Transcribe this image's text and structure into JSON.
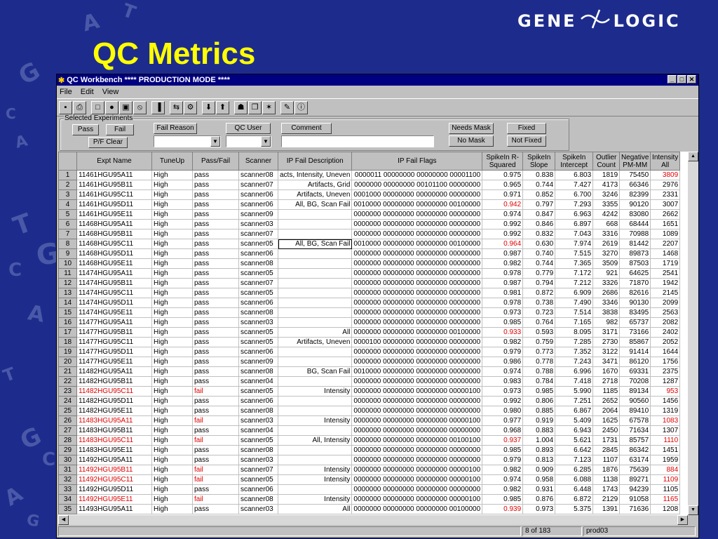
{
  "slide": {
    "title": "QC Metrics"
  },
  "logo": {
    "left": "GENE",
    "right": "LOGIC"
  },
  "bg_letters": [
    "A",
    "T",
    "G",
    "C",
    "A",
    "T",
    "G",
    "C",
    "A",
    "T",
    "G",
    "C",
    "A",
    "G"
  ],
  "window": {
    "title": "QC Workbench **** PRODUCTION MODE ****",
    "controls": [
      "_",
      "□",
      "✕"
    ],
    "menu": [
      "File",
      "Edit",
      "View"
    ]
  },
  "toolbar_icons": [
    {
      "name": "save-icon",
      "glyph": "▪"
    },
    {
      "name": "print-icon",
      "glyph": "⎙"
    },
    {
      "name": "print-preview-icon",
      "glyph": "□"
    },
    {
      "name": "camera-icon",
      "glyph": "●"
    },
    {
      "name": "copy-icon",
      "glyph": "▣"
    },
    {
      "name": "no-entry-icon",
      "glyph": "⦸"
    },
    {
      "name": "chart-icon",
      "glyph": "▐"
    },
    {
      "name": "transfer-icon",
      "glyph": "⇆"
    },
    {
      "name": "gear-icon",
      "glyph": "⚙"
    },
    {
      "name": "arrow-down-icon",
      "glyph": "⬇"
    },
    {
      "name": "arrow-up-icon",
      "glyph": "⬆"
    },
    {
      "name": "scanner-icon",
      "glyph": "☗"
    },
    {
      "name": "document-icon",
      "glyph": "❐"
    },
    {
      "name": "stamp-icon",
      "glyph": "✶"
    },
    {
      "name": "edit-icon",
      "glyph": "✎"
    },
    {
      "name": "info-icon",
      "glyph": "ⓘ"
    }
  ],
  "selected_experiments": {
    "legend": "Selected Experiments",
    "pass": "Pass",
    "fail": "Fail",
    "pf_clear": "P/F Clear",
    "fail_reason": "Fail Reason",
    "qc_user": "QC User",
    "comment": "Comment",
    "needs_mask": "Needs Mask",
    "no_mask": "No Mask",
    "fixed": "Fixed",
    "not_fixed": "Not Fixed"
  },
  "columns": [
    "Expt Name",
    "TuneUp",
    "Pass/Fail",
    "Scanner",
    "IP Fail Description",
    "IP Fail Flags",
    "SpikeIn R-Squared",
    "SpikeIn Slope",
    "SpikeIn Intercept",
    "Outlier Count",
    "Negative PM-MM",
    "Intensity All"
  ],
  "rows": [
    [
      "1",
      "11461HGU95A11",
      "High",
      "pass",
      "scanner08",
      "acts, Intensity, Uneven",
      "0000011 00000000 00000000 00001100",
      "0.975",
      "0.838",
      "6.803",
      "1819",
      "75450",
      "3809"
    ],
    [
      "2",
      "11461HGU95B11",
      "High",
      "pass",
      "scanner07",
      "Artifacts, Grid",
      "0000000 00000000 00101100 00000000",
      "0.965",
      "0.744",
      "7.427",
      "4173",
      "66346",
      "2976"
    ],
    [
      "3",
      "11461HGU95C11",
      "High",
      "pass",
      "scanner06",
      "Artifacts, Uneven",
      "0001000 00000000 00000000 00000000",
      "0.971",
      "0.852",
      "6.700",
      "3246",
      "82399",
      "2331"
    ],
    [
      "4",
      "11461HGU95D11",
      "High",
      "pass",
      "scanner06",
      "All, BG, Scan Fail",
      "0010000 00000000 00000000 00100000",
      "0.942",
      "0.797",
      "7.293",
      "3355",
      "90120",
      "3007"
    ],
    [
      "5",
      "11461HGU95E11",
      "High",
      "pass",
      "scanner09",
      "",
      "0000000 00000000 00000000 00000000",
      "0.974",
      "0.847",
      "6.963",
      "4242",
      "83080",
      "2662"
    ],
    [
      "6",
      "11468HGU95A11",
      "High",
      "pass",
      "scanner03",
      "",
      "0000000 00000000 00000000 00000000",
      "0.992",
      "0.846",
      "6.897",
      "668",
      "68444",
      "1651"
    ],
    [
      "7",
      "11468HGU95B11",
      "High",
      "pass",
      "scanner07",
      "",
      "0000000 00000000 00000000 00000000",
      "0.992",
      "0.832",
      "7.043",
      "3316",
      "70988",
      "1089"
    ],
    [
      "8",
      "11468HGU95C11",
      "High",
      "pass",
      "scanner05",
      "All, BG, Scan Fail",
      "0010000 00000000 00000000 00100000",
      "0.964",
      "0.630",
      "7.974",
      "2619",
      "81442",
      "2207"
    ],
    [
      "9",
      "11468HGU95D11",
      "High",
      "pass",
      "scanner06",
      "",
      "0000000 00000000 00000000 00000000",
      "0.987",
      "0.740",
      "7.515",
      "3270",
      "89873",
      "1468"
    ],
    [
      "10",
      "11468HGU95E11",
      "High",
      "pass",
      "scanner08",
      "",
      "0000000 00000000 00000000 00000000",
      "0.982",
      "0.744",
      "7.365",
      "3509",
      "87503",
      "1719"
    ],
    [
      "11",
      "11474HGU95A11",
      "High",
      "pass",
      "scanner05",
      "",
      "0000000 00000000 00000000 00000000",
      "0.978",
      "0.779",
      "7.172",
      "921",
      "64625",
      "2541"
    ],
    [
      "12",
      "11474HGU95B11",
      "High",
      "pass",
      "scanner07",
      "",
      "0000000 00000000 00000000 00000000",
      "0.987",
      "0.794",
      "7.212",
      "3326",
      "71870",
      "1942"
    ],
    [
      "13",
      "11474HGU95C11",
      "High",
      "pass",
      "scanner05",
      "",
      "0000000 00000000 00000000 00000000",
      "0.981",
      "0.872",
      "6.909",
      "2686",
      "82616",
      "2145"
    ],
    [
      "14",
      "11474HGU95D11",
      "High",
      "pass",
      "scanner06",
      "",
      "0000000 00000000 00000000 00000000",
      "0.978",
      "0.738",
      "7.490",
      "3346",
      "90130",
      "2099"
    ],
    [
      "15",
      "11474HGU95E11",
      "High",
      "pass",
      "scanner08",
      "",
      "0000000 00000000 00000000 00000000",
      "0.973",
      "0.723",
      "7.514",
      "3838",
      "83495",
      "2563"
    ],
    [
      "16",
      "11477HGU95A11",
      "High",
      "pass",
      "scanner03",
      "",
      "0000000 00000000 00000000 00000000",
      "0.985",
      "0.764",
      "7.165",
      "982",
      "65737",
      "2082"
    ],
    [
      "17",
      "11477HGU95B11",
      "High",
      "pass",
      "scanner05",
      "All",
      "0000000 00000000 00000000 00100000",
      "0.933",
      "0.593",
      "8.095",
      "3171",
      "73166",
      "2402"
    ],
    [
      "18",
      "11477HGU95C11",
      "High",
      "pass",
      "scanner05",
      "Artifacts, Uneven",
      "0000100 00000000 00000000 00000000",
      "0.982",
      "0.759",
      "7.285",
      "2730",
      "85867",
      "2052"
    ],
    [
      "19",
      "11477HGU95D11",
      "High",
      "pass",
      "scanner06",
      "",
      "0000000 00000000 00000000 00000000",
      "0.979",
      "0.773",
      "7.352",
      "3122",
      "91414",
      "1644"
    ],
    [
      "20",
      "11477HGU95E11",
      "High",
      "pass",
      "scanner09",
      "",
      "0000000 00000000 00000000 00000000",
      "0.986",
      "0.778",
      "7.243",
      "3471",
      "86120",
      "1756"
    ],
    [
      "21",
      "11482HGU95A11",
      "High",
      "pass",
      "scanner08",
      "BG, Scan Fail",
      "0010000 00000000 00000000 00000000",
      "0.974",
      "0.788",
      "6.996",
      "1670",
      "69331",
      "2375"
    ],
    [
      "22",
      "11482HGU95B11",
      "High",
      "pass",
      "scanner04",
      "",
      "0000000 00000000 00000000 00000000",
      "0.983",
      "0.784",
      "7.418",
      "2718",
      "70208",
      "1287"
    ],
    [
      "23",
      "11482HGU95C11",
      "High",
      "fail",
      "scanner05",
      "Intensity",
      "0000000 00000000 00000000 00000100",
      "0.973",
      "0.985",
      "5.990",
      "1185",
      "89134",
      "953"
    ],
    [
      "24",
      "11482HGU95D11",
      "High",
      "pass",
      "scanner06",
      "",
      "0000000 00000000 00000000 00000000",
      "0.992",
      "0.806",
      "7.251",
      "2652",
      "90560",
      "1456"
    ],
    [
      "25",
      "11482HGU95E11",
      "High",
      "pass",
      "scanner08",
      "",
      "0000000 00000000 00000000 00000000",
      "0.980",
      "0.885",
      "6.867",
      "2064",
      "89410",
      "1319"
    ],
    [
      "26",
      "11483HGU95A11",
      "High",
      "fail",
      "scanner03",
      "Intensity",
      "0000000 00000000 00000000 00000100",
      "0.977",
      "0.919",
      "5.409",
      "1625",
      "67578",
      "1083"
    ],
    [
      "27",
      "11483HGU95B11",
      "High",
      "pass",
      "scanner04",
      "",
      "0000000 00000000 00000000 00000000",
      "0.968",
      "0.883",
      "6.943",
      "2450",
      "71634",
      "1307"
    ],
    [
      "28",
      "11483HGU95C11",
      "High",
      "fail",
      "scanner05",
      "All, Intensity",
      "0000000 00000000 00000000 00100100",
      "0.937",
      "1.004",
      "5.621",
      "1731",
      "85757",
      "1110"
    ],
    [
      "29",
      "11483HGU95E11",
      "High",
      "pass",
      "scanner08",
      "",
      "0000000 00000000 00000000 00000000",
      "0.985",
      "0.893",
      "6.642",
      "2845",
      "86342",
      "1451"
    ],
    [
      "30",
      "11492HGU95A11",
      "High",
      "pass",
      "scanner03",
      "",
      "0000000 00000000 00000000 00000000",
      "0.979",
      "0.813",
      "7.123",
      "1107",
      "63174",
      "1959"
    ],
    [
      "31",
      "11492HGU95B11",
      "High",
      "fail",
      "scanner07",
      "Intensity",
      "0000000 00000000 00000000 00000100",
      "0.982",
      "0.909",
      "6.285",
      "1876",
      "75639",
      "884"
    ],
    [
      "32",
      "11492HGU95C11",
      "High",
      "fail",
      "scanner05",
      "Intensity",
      "0000000 00000000 00000000 00000100",
      "0.974",
      "0.958",
      "6.088",
      "1138",
      "89271",
      "1109"
    ],
    [
      "33",
      "11492HGU95D11",
      "High",
      "pass",
      "scanner06",
      "",
      "0000000 00000000 00000000 00000000",
      "0.982",
      "0.931",
      "6.448",
      "1743",
      "94239",
      "1105"
    ],
    [
      "34",
      "11492HGU95E11",
      "High",
      "fail",
      "scanner08",
      "Intensity",
      "0000000 00000000 00000000 00000100",
      "0.985",
      "0.876",
      "6.872",
      "2129",
      "91058",
      "1165"
    ],
    [
      "35",
      "11493HGU95A11",
      "High",
      "pass",
      "scanner03",
      "All",
      "0000000 00000000 00000000 00100000",
      "0.939",
      "0.973",
      "5.375",
      "1391",
      "71636",
      "1208"
    ]
  ],
  "red_cells": {
    "0": [
      12
    ],
    "3": [
      7
    ],
    "7": [
      7
    ],
    "16": [
      7
    ],
    "22": [
      1,
      3,
      12
    ],
    "25": [
      1,
      3,
      12
    ],
    "27": [
      1,
      3,
      7,
      12
    ],
    "30": [
      1,
      3,
      12
    ],
    "31": [
      1,
      3,
      12
    ],
    "33": [
      1,
      3,
      12
    ],
    "34": [
      7
    ]
  },
  "status": {
    "position": "8 of 183",
    "user": "prod03"
  },
  "colors": {
    "slide_bg": "#1d2c8c",
    "title": "#ffff00",
    "titlebar": "#000080",
    "fail_text": "#e00000"
  }
}
